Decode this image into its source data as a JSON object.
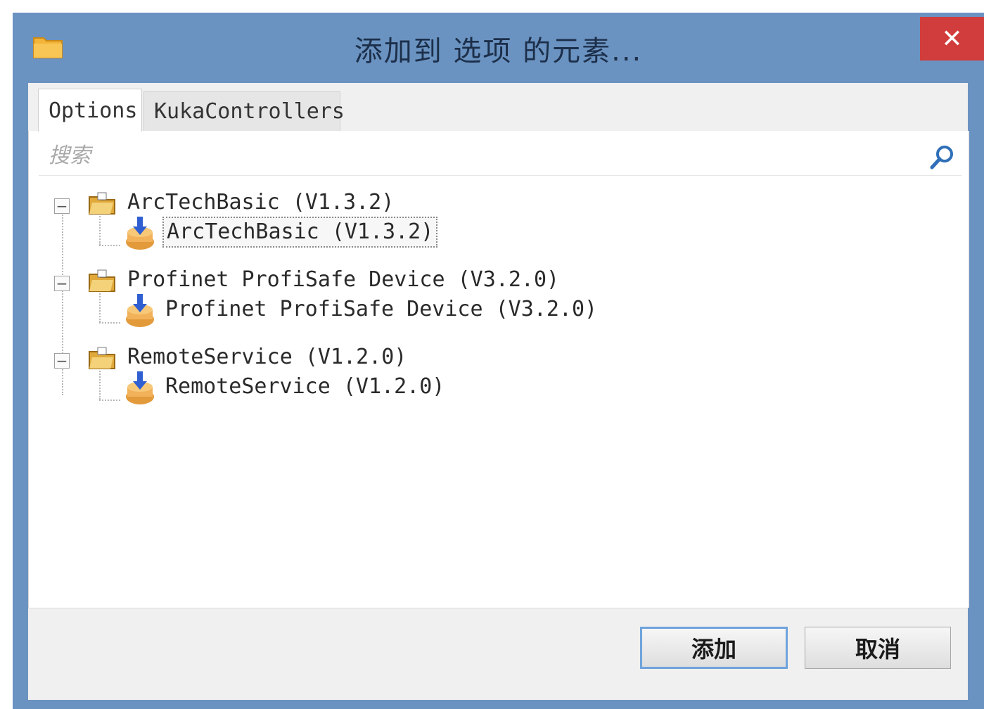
{
  "window": {
    "title": "添加到 选项 的元素...",
    "close_label": "✕"
  },
  "tabs": [
    {
      "label": "Options",
      "active": true
    },
    {
      "label": "KukaControllers",
      "active": false
    }
  ],
  "search": {
    "placeholder": "搜索"
  },
  "tree": [
    {
      "label": "ArcTechBasic (V1.3.2)",
      "expanded": true,
      "children": [
        {
          "label": "ArcTechBasic (V1.3.2)",
          "selected": true
        }
      ]
    },
    {
      "label": "Profinet ProfiSafe Device (V3.2.0)",
      "expanded": true,
      "children": [
        {
          "label": "Profinet ProfiSafe Device (V3.2.0)",
          "selected": false
        }
      ]
    },
    {
      "label": "RemoteService (V1.2.0)",
      "expanded": true,
      "children": [
        {
          "label": "RemoteService (V1.2.0)",
          "selected": false
        }
      ]
    }
  ],
  "buttons": {
    "add_label": "添加",
    "cancel_label": "取消"
  },
  "colors": {
    "titlebar": "#6b93c1",
    "close": "#d13c3c",
    "default_button_border": "#6fa3dc"
  }
}
